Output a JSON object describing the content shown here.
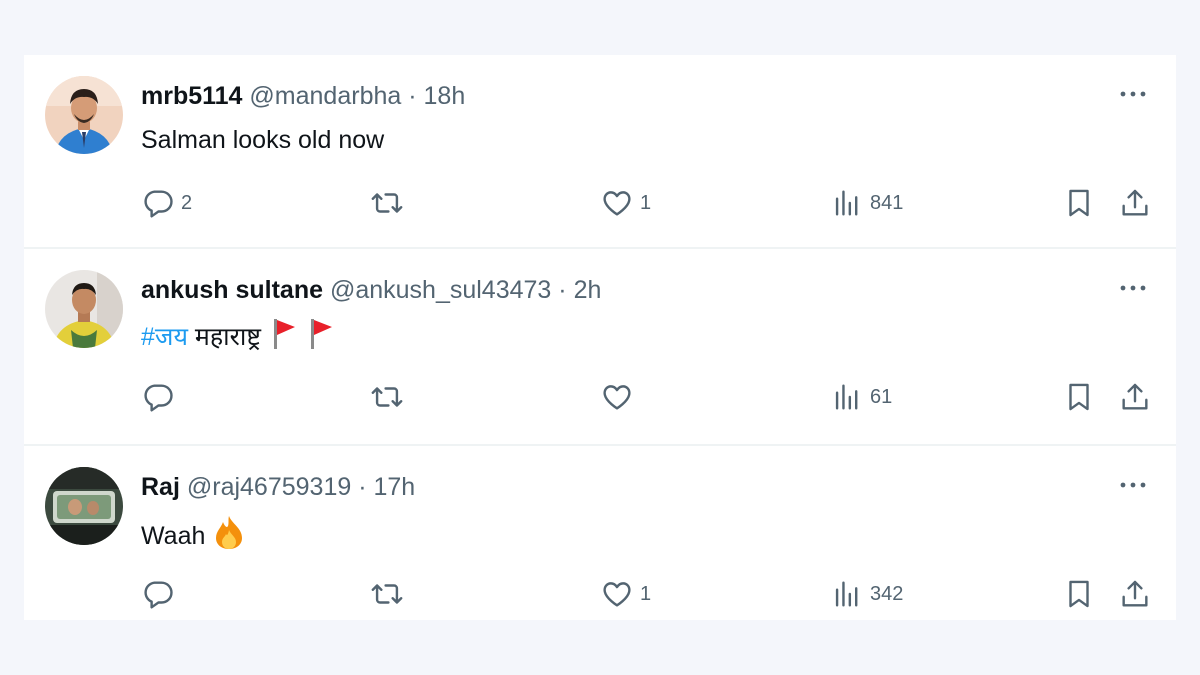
{
  "tweets": [
    {
      "name": "mrb5114",
      "handle": "@mandarbha",
      "separator": "·",
      "time": "18h",
      "text": "Salman looks old now",
      "replies": "2",
      "reposts": "",
      "likes": "1",
      "views": "841",
      "avatar_icon": "man-in-blue-suit-avatar"
    },
    {
      "name": "ankush sultane",
      "handle": "@ankush_sul43473",
      "separator": "·",
      "time": "2h",
      "hashtag": "#जय",
      "text": "महाराष्ट्र",
      "emoji": [
        "red-flag-emoji",
        "red-flag-emoji"
      ],
      "replies": "",
      "reposts": "",
      "likes": "",
      "views": "61",
      "avatar_icon": "man-in-yellow-shirt-avatar"
    },
    {
      "name": "Raj",
      "handle": "@raj46759319",
      "separator": "·",
      "time": "17h",
      "text": "Waah",
      "emoji": [
        "fire-emoji"
      ],
      "replies": "",
      "reposts": "",
      "likes": "1",
      "views": "342",
      "avatar_icon": "car-window-avatar"
    }
  ],
  "colors": {
    "background": "#f4f6fb",
    "card": "#ffffff",
    "text_primary": "#0f1419",
    "text_secondary": "#536471",
    "link": "#1d9bf0",
    "divider": "#eff3f4"
  }
}
